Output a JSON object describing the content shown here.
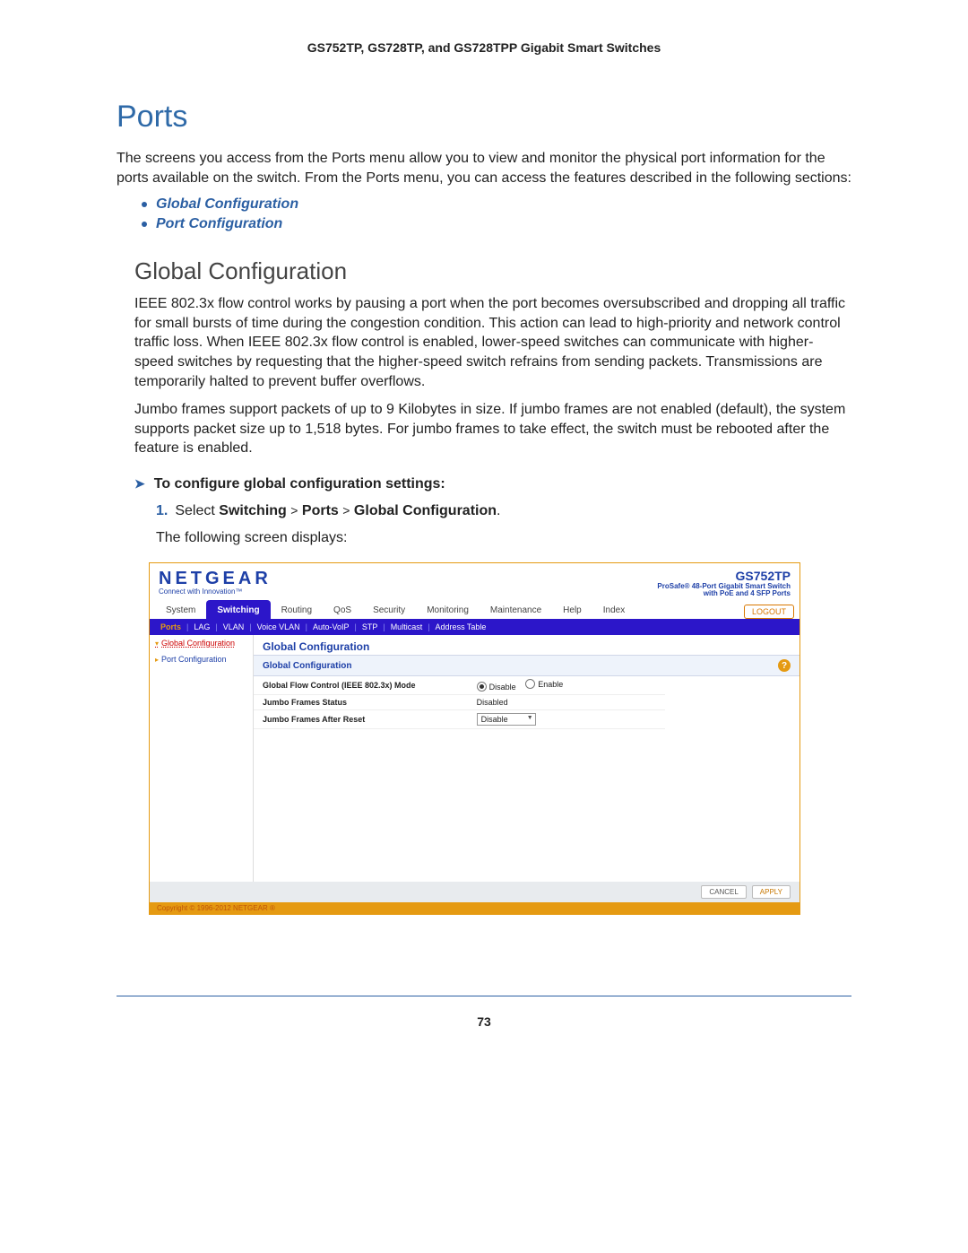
{
  "header": "GS752TP, GS728TP, and GS728TPP Gigabit Smart Switches",
  "h1": "Ports",
  "intro": "The screens you access from the Ports menu allow you to view and monitor the physical port information for the ports available on the switch. From the Ports menu, you can access the features described in the following sections:",
  "links": {
    "a": "Global Configuration",
    "b": "Port Configuration"
  },
  "h2": "Global Configuration",
  "para1": "IEEE 802.3x flow control works by pausing a port when the port becomes oversubscribed and dropping all traffic for small bursts of time during the congestion condition. This action can lead to high-priority and network control traffic loss. When IEEE 802.3x flow control is enabled, lower-speed switches can communicate with higher-speed switches by requesting that the higher-speed switch refrains from sending packets. Transmissions are temporarily halted to prevent buffer overflows.",
  "para2": "Jumbo frames support packets of up to 9 Kilobytes in size. If jumbo frames are not enabled (default), the system supports packet size up to 1,518 bytes. For jumbo frames to take effect, the switch must be rebooted after the feature is enabled.",
  "proc": "To configure global configuration settings:",
  "step1_pre": "Select ",
  "step1_a": "Switching",
  "step1_b": "Ports",
  "step1_c": "Global Configuration",
  "following": "The following screen displays:",
  "ui": {
    "brand": "NETGEAR",
    "brand_sub": "Connect with Innovation™",
    "model": "GS752TP",
    "model_sub1": "ProSafe® 48-Port Gigabit Smart Switch",
    "model_sub2": "with PoE and 4 SFP Ports",
    "tabs": [
      "System",
      "Switching",
      "Routing",
      "QoS",
      "Security",
      "Monitoring",
      "Maintenance",
      "Help",
      "Index"
    ],
    "logout": "LOGOUT",
    "subnav": [
      "Ports",
      "LAG",
      "VLAN",
      "Voice VLAN",
      "Auto-VoIP",
      "STP",
      "Multicast",
      "Address Table"
    ],
    "side": {
      "a": "Global Configuration",
      "b": "Port Configuration"
    },
    "panel_title": "Global Configuration",
    "panel_head": "Global Configuration",
    "row1_label": "Global Flow Control (IEEE 802.3x) Mode",
    "row1_opt1": "Disable",
    "row1_opt2": "Enable",
    "row2_label": "Jumbo Frames Status",
    "row2_val": "Disabled",
    "row3_label": "Jumbo Frames After Reset",
    "row3_val": "Disable",
    "btn_cancel": "CANCEL",
    "btn_apply": "APPLY",
    "copyright": "Copyright © 1996-2012 NETGEAR ®"
  },
  "page_number": "73"
}
